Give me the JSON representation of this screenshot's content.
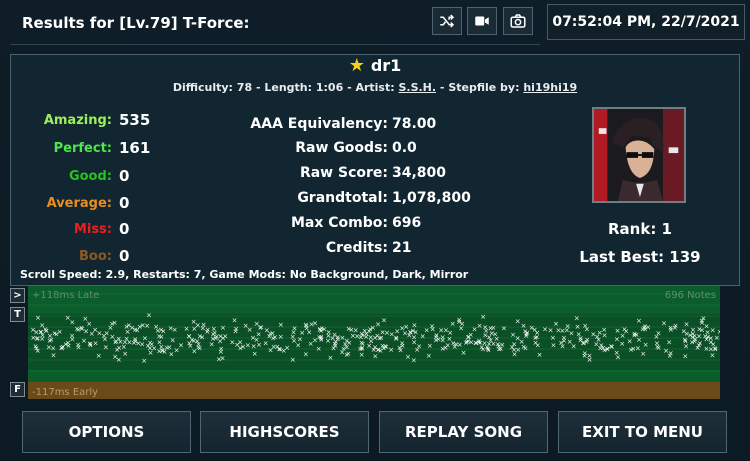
{
  "header": {
    "title": "Results for [Lv.79] T-Force:",
    "datetime": "07:52:04 PM, 22/7/2021",
    "icons": [
      "shuffle-icon",
      "video-camera-icon",
      "camera-icon"
    ]
  },
  "song": {
    "name": "dr1",
    "difficulty_label": "Difficulty:",
    "difficulty": "78",
    "length_label": "Length:",
    "length": "1:06",
    "artist_label": "Artist:",
    "artist": "S.S.H.",
    "stepfile_label": "Stepfile by:",
    "stepfile_by": "hi19hi19"
  },
  "judgements": [
    {
      "label": "Amazing:",
      "value": "535",
      "color": "#9ef05a"
    },
    {
      "label": "Perfect:",
      "value": "161",
      "color": "#4ee64a"
    },
    {
      "label": "Good:",
      "value": "0",
      "color": "#26c21d"
    },
    {
      "label": "Average:",
      "value": "0",
      "color": "#e88d1f"
    },
    {
      "label": "Miss:",
      "value": "0",
      "color": "#e82020"
    },
    {
      "label": "Boo:",
      "value": "0",
      "color": "#8b5a22"
    }
  ],
  "stats": [
    {
      "label": "AAA Equivalency:",
      "value": "78.00"
    },
    {
      "label": "Raw Goods:",
      "value": "0.0"
    },
    {
      "label": "Raw Score:",
      "value": "34,800"
    },
    {
      "label": "Grandtotal:",
      "value": "1,078,800"
    },
    {
      "label": "Max Combo:",
      "value": "696"
    },
    {
      "label": "Credits:",
      "value": "21"
    }
  ],
  "rank": {
    "label": "Rank: 1",
    "last_best": "Last Best: 139"
  },
  "scroll_info": "Scroll Speed: 2.9, Restarts: 7, Game Mods: No Background, Dark, Mirror",
  "graph": {
    "late_label": "+118ms Late",
    "early_label": "-117ms Early",
    "notes_label": "696 Notes",
    "side_buttons": [
      ">",
      "T",
      "F"
    ]
  },
  "buttons": {
    "options": "OPTIONS",
    "highscores": "HIGHSCORES",
    "replay": "REPLAY SONG",
    "exit": "EXIT TO MENU"
  },
  "colors": {
    "graph_green": "#0b5d2c",
    "graph_band": "#0a4521",
    "graph_early": "#6b4a1a",
    "marker": "#ffffff"
  }
}
